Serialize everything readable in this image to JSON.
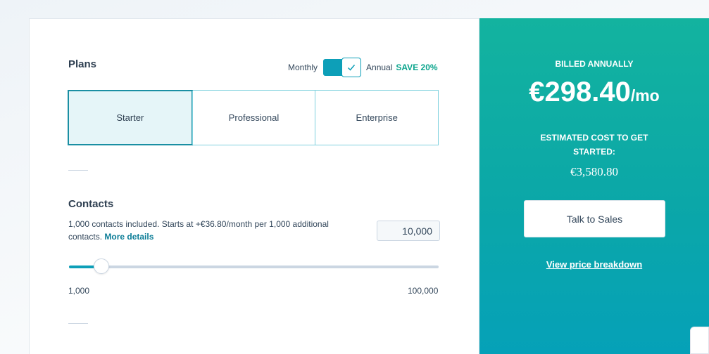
{
  "plans": {
    "title": "Plans",
    "billing_toggle": {
      "left_label": "Monthly",
      "right_label": "Annual",
      "save_badge": "SAVE 20%",
      "selected": "Annual"
    },
    "tabs": [
      {
        "label": "Starter",
        "active": true
      },
      {
        "label": "Professional",
        "active": false
      },
      {
        "label": "Enterprise",
        "active": false
      }
    ]
  },
  "contacts": {
    "title": "Contacts",
    "description": "1,000 contacts included. Starts at +€36.80/month per 1,000 additional contacts.",
    "more_link": "More details",
    "input_value": "10,000",
    "slider": {
      "min_label": "1,000",
      "max_label": "100,000",
      "value_fraction": 0.09
    }
  },
  "pricing": {
    "billed_label": "BILLED ANNUALLY",
    "price": "€298.40",
    "price_unit": "/mo",
    "estimated_label": "ESTIMATED COST TO GET STARTED:",
    "estimated_value": "€3,580.80",
    "sales_button": "Talk to Sales",
    "breakdown_link": "View price breakdown"
  },
  "colors": {
    "accent": "#0d9fb8",
    "save_green": "#0ba58d",
    "panel_top": "#13b39f",
    "panel_bottom": "#05a1b8"
  },
  "icons": {
    "toggle_check": "checkmark-icon"
  }
}
